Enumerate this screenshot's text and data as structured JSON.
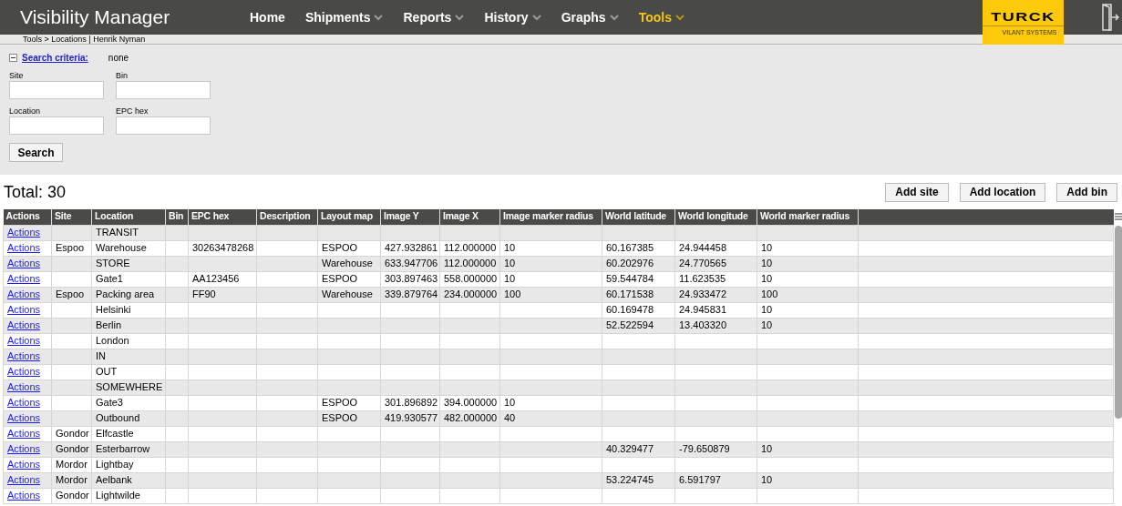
{
  "app": {
    "title": "Visibility Manager"
  },
  "nav": [
    {
      "label": "Home",
      "has_menu": false,
      "selected": false
    },
    {
      "label": "Shipments",
      "has_menu": true,
      "selected": false
    },
    {
      "label": "Reports",
      "has_menu": true,
      "selected": false
    },
    {
      "label": "History",
      "has_menu": true,
      "selected": false
    },
    {
      "label": "Graphs",
      "has_menu": true,
      "selected": false
    },
    {
      "label": "Tools",
      "has_menu": true,
      "selected": true
    }
  ],
  "logo": {
    "name": "TURCK",
    "tagline": "VILANT SYSTEMS"
  },
  "breadcrumb": "Tools > Locations | Henrik Nyman",
  "search": {
    "expanded": true,
    "link": "Search criteria:",
    "summary": "none",
    "fields": [
      {
        "label": "Site"
      },
      {
        "label": "Bin"
      },
      {
        "label": "Location"
      },
      {
        "label": "EPC hex"
      }
    ],
    "button": "Search"
  },
  "total": "Total: 30",
  "actions": [
    "Add site",
    "Add location",
    "Add bin"
  ],
  "table": {
    "columns": [
      "Actions",
      "Site",
      "Location",
      "Bin",
      "EPC hex",
      "Description",
      "Layout map",
      "Image Y",
      "Image X",
      "Image marker radius",
      "World latitude",
      "World longitude",
      "World marker radius"
    ],
    "rows": [
      {
        "cells": [
          "Actions",
          null,
          "TRANSIT",
          null,
          null,
          null,
          null,
          null,
          null,
          null,
          null,
          null,
          null
        ]
      },
      {
        "cells": [
          "Actions",
          "Espoo",
          "Warehouse",
          null,
          "30263478268",
          null,
          "ESPOO",
          "427.932861",
          "112.000000",
          "10",
          "60.167385",
          "24.944458",
          "10"
        ]
      },
      {
        "cells": [
          "Actions",
          null,
          "STORE",
          null,
          null,
          null,
          "Warehouse",
          "633.947706",
          "112.000000",
          "10",
          "60.202976",
          "24.770565",
          "10"
        ]
      },
      {
        "cells": [
          "Actions",
          null,
          "Gate1",
          null,
          "AA123456",
          null,
          "ESPOO",
          "303.897463",
          "558.000000",
          "10",
          "59.544784",
          "11.623535",
          "10"
        ]
      },
      {
        "cells": [
          "Actions",
          "Espoo",
          "Packing area",
          null,
          "FF90",
          null,
          "Warehouse",
          "339.879764",
          "234.000000",
          "100",
          "60.171538",
          "24.933472",
          "100"
        ]
      },
      {
        "cells": [
          "Actions",
          null,
          "Helsinki",
          null,
          null,
          null,
          null,
          null,
          null,
          null,
          "60.169478",
          "24.945831",
          "10"
        ]
      },
      {
        "cells": [
          "Actions",
          null,
          "Berlin",
          null,
          null,
          null,
          null,
          null,
          null,
          null,
          "52.522594",
          "13.403320",
          "10"
        ]
      },
      {
        "cells": [
          "Actions",
          null,
          "London",
          null,
          null,
          null,
          null,
          null,
          null,
          null,
          null,
          null,
          null
        ]
      },
      {
        "cells": [
          "Actions",
          null,
          "IN",
          null,
          null,
          null,
          null,
          null,
          null,
          null,
          null,
          null,
          null
        ]
      },
      {
        "cells": [
          "Actions",
          null,
          "OUT",
          null,
          null,
          null,
          null,
          null,
          null,
          null,
          null,
          null,
          null
        ]
      },
      {
        "cells": [
          "Actions",
          null,
          "SOMEWHERE",
          null,
          null,
          null,
          null,
          null,
          null,
          null,
          null,
          null,
          null
        ]
      },
      {
        "cells": [
          "Actions",
          null,
          "Gate3",
          null,
          null,
          null,
          "ESPOO",
          "301.896892",
          "394.000000",
          "10",
          null,
          null,
          null
        ]
      },
      {
        "cells": [
          "Actions",
          null,
          "Outbound",
          null,
          null,
          null,
          "ESPOO",
          "419.930577",
          "482.000000",
          "40",
          null,
          null,
          null
        ]
      },
      {
        "cells": [
          "Actions",
          "Gondor",
          "Elfcastle",
          null,
          null,
          null,
          null,
          null,
          null,
          null,
          null,
          null,
          null
        ]
      },
      {
        "cells": [
          "Actions",
          "Gondor",
          "Esterbarrow",
          null,
          null,
          null,
          null,
          null,
          null,
          null,
          "40.329477",
          "-79.650879",
          "10"
        ]
      },
      {
        "cells": [
          "Actions",
          "Mordor",
          "Lightbay",
          null,
          null,
          null,
          null,
          null,
          null,
          null,
          null,
          null,
          null
        ]
      },
      {
        "cells": [
          "Actions",
          "Mordor",
          "Aelbank",
          null,
          null,
          null,
          null,
          null,
          null,
          null,
          "53.224745",
          "6.591797",
          "10"
        ]
      },
      {
        "cells": [
          "Actions",
          "Gondor",
          "Lightwilde",
          null,
          null,
          null,
          null,
          null,
          null,
          null,
          null,
          null,
          null
        ]
      }
    ]
  }
}
